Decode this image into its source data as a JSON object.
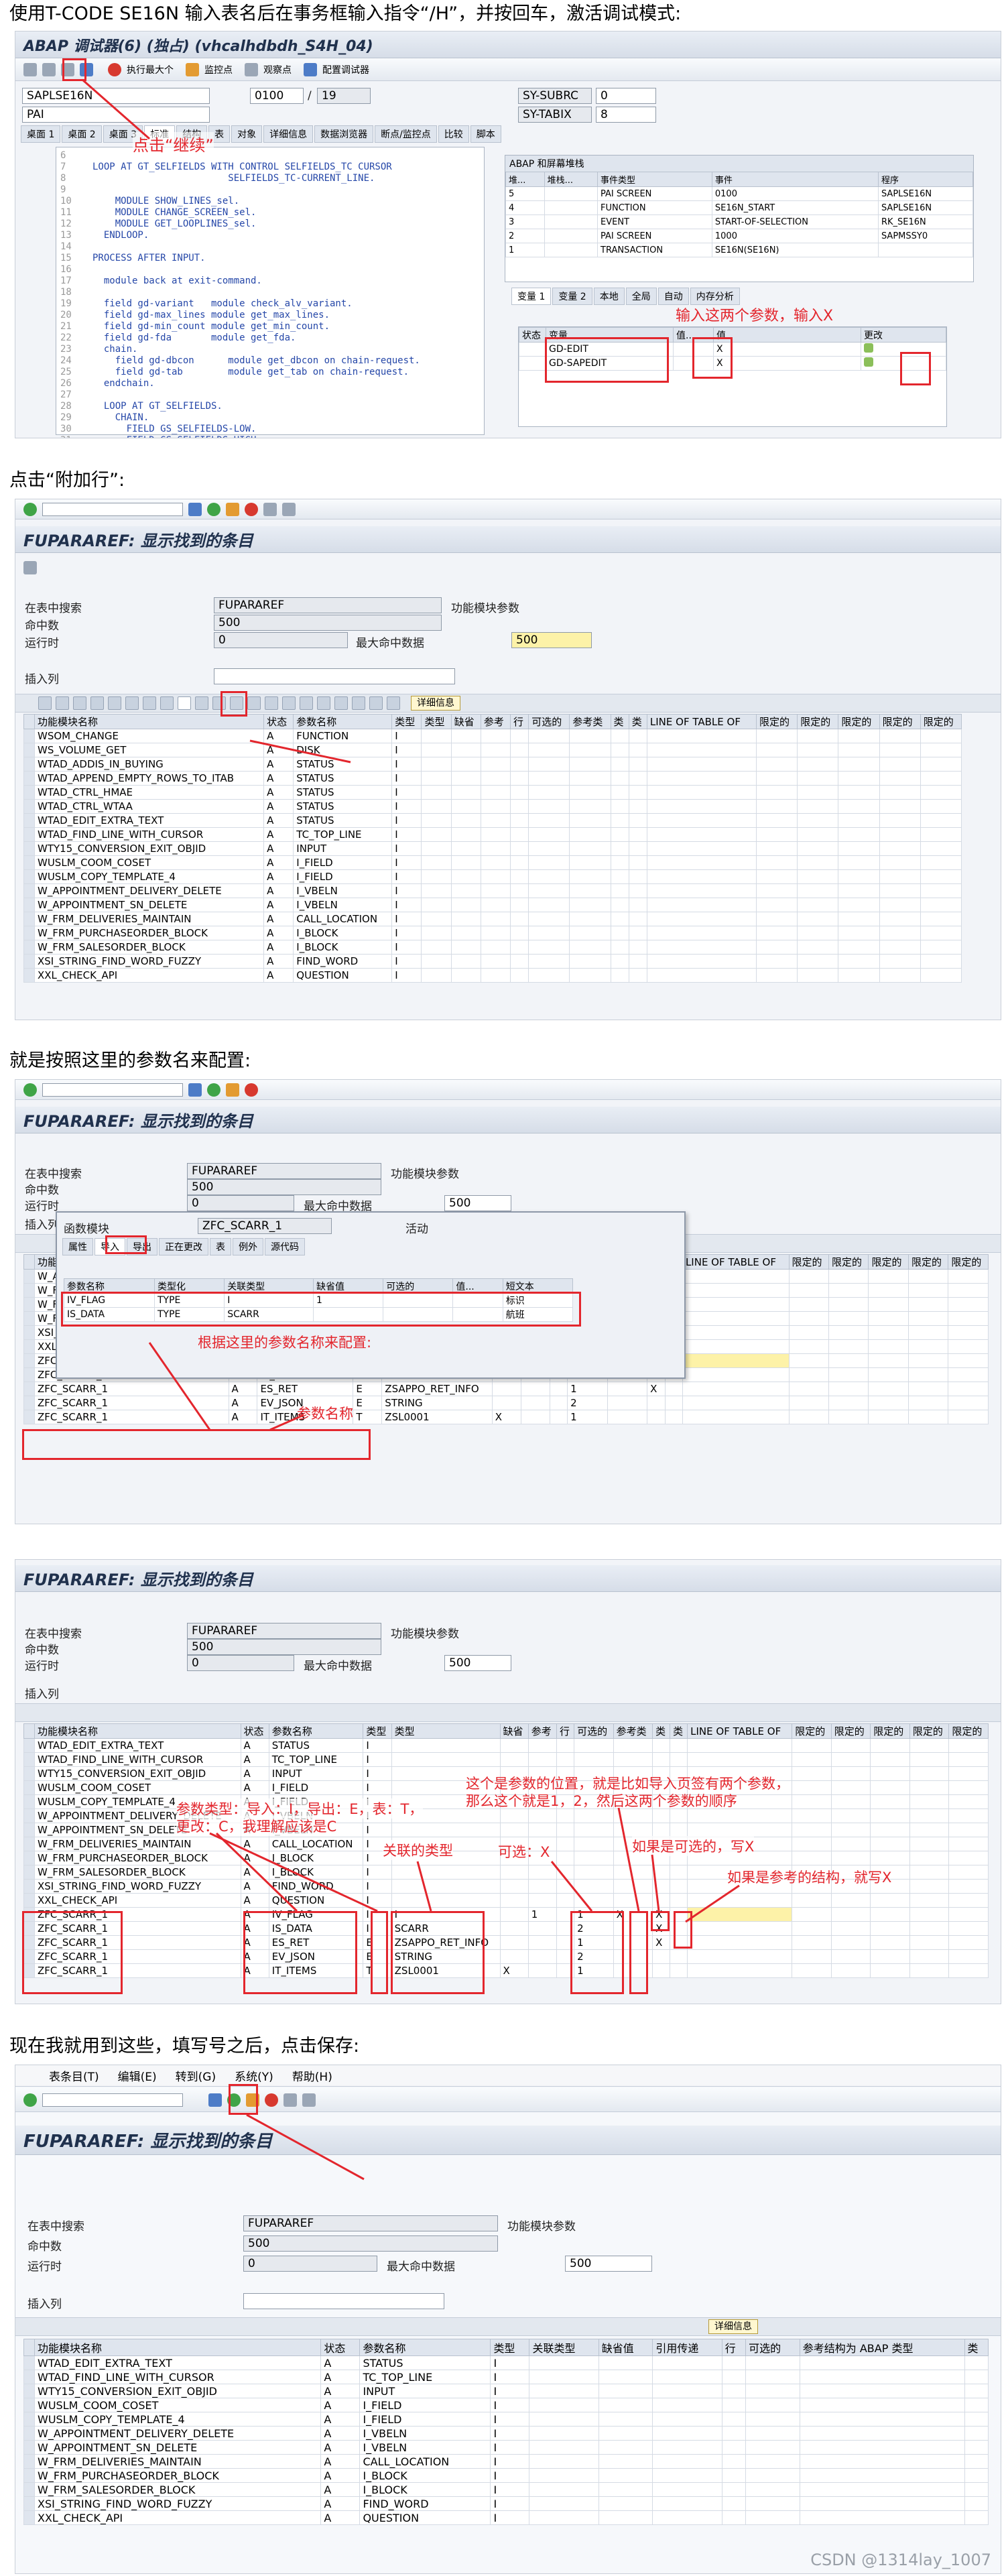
{
  "captions": {
    "step1": "使用T-CODE SE16N 输入表名后在事务框输入指令“/H”，并按回车，激活调试模式:",
    "step2": "点击“附加行”:",
    "step3": "就是按照这里的参数名来配置:",
    "step5": "现在我就用到这些，填写号之后，点击保存:"
  },
  "shot1": {
    "title": "ABAP 调试器(6) (独占) (vhcalhdbdh_S4H_04)",
    "toolbar_labels": [
      "执行最大个",
      "监控点",
      "观察点",
      "配置调试器"
    ],
    "program_field": "SAPLSE16N",
    "line_field": "0100",
    "line_total": "19",
    "pai_field": "PAI",
    "sy_fields": [
      {
        "name": "SY-SUBRC",
        "value": "0"
      },
      {
        "name": "SY-TABIX",
        "value": "8"
      }
    ],
    "tabs": [
      "桌面 1",
      "桌面 2",
      "桌面 3",
      "标准",
      "结构",
      "表",
      "对象",
      "详细信息",
      "数据浏览器",
      "断点/监控点",
      "比较",
      "脚本"
    ],
    "code_lines": [
      {
        "n": "6",
        "t": ""
      },
      {
        "n": "7",
        "t": "LOOP AT GT_SELFIELDS WITH CONTROL SELFIELDS_TC CURSOR"
      },
      {
        "n": "8",
        "t": "                        SELFIELDS_TC-CURRENT_LINE."
      },
      {
        "n": "9",
        "t": ""
      },
      {
        "n": "10",
        "t": "    MODULE SHOW_LINES_sel."
      },
      {
        "n": "11",
        "t": "    MODULE CHANGE_SCREEN_sel."
      },
      {
        "n": "12",
        "t": "    MODULE GET_LOOPLINES_sel."
      },
      {
        "n": "13",
        "t": "  ENDLOOP."
      },
      {
        "n": "14",
        "t": ""
      },
      {
        "n": "15",
        "t": "PROCESS AFTER INPUT."
      },
      {
        "n": "16",
        "t": ""
      },
      {
        "n": "17",
        "t": "  module back at exit-command."
      },
      {
        "n": "18",
        "t": ""
      },
      {
        "n": "19",
        "t": "  field gd-variant   module check_alv_variant."
      },
      {
        "n": "20",
        "t": "  field gd-max_lines module get_max_lines."
      },
      {
        "n": "21",
        "t": "  field gd-min_count module get_min_count."
      },
      {
        "n": "22",
        "t": "  field gd-fda       module get_fda."
      },
      {
        "n": "23",
        "t": "  chain."
      },
      {
        "n": "24",
        "t": "    field gd-dbcon      module get_dbcon on chain-request."
      },
      {
        "n": "25",
        "t": "    field gd-tab        module get_tab on chain-request."
      },
      {
        "n": "26",
        "t": "  endchain."
      },
      {
        "n": "27",
        "t": ""
      },
      {
        "n": "28",
        "t": "  LOOP AT GT_SELFIELDS."
      },
      {
        "n": "29",
        "t": "    CHAIN."
      },
      {
        "n": "30",
        "t": "      FIELD GS_SELFIELDS-LOW."
      },
      {
        "n": "31",
        "t": "      FIELD GS_SELFIELDS-HIGH."
      }
    ],
    "stack_title": "ABAP 和屏幕堆栈",
    "stack_headers": [
      "堆...",
      "堆栈...",
      "事件类型",
      "事件",
      "程序"
    ],
    "stack_rows": [
      [
        "5",
        "",
        "PAI SCREEN",
        "0100",
        "SAPLSE16N"
      ],
      [
        "4",
        "",
        "FUNCTION",
        "SE16N_START",
        "SAPLSE16N"
      ],
      [
        "3",
        "",
        "EVENT",
        "START-OF-SELECTION",
        "RK_SE16N"
      ],
      [
        "2",
        "",
        "PAI SCREEN",
        "1000",
        "SAPMSSY0"
      ],
      [
        "1",
        "",
        "TRANSACTION",
        "SE16N(SE16N)",
        ""
      ]
    ],
    "var_tabs": [
      "变量 1",
      "变量 2",
      "本地",
      "全局",
      "自动",
      "内存分析"
    ],
    "var_headers": [
      "状态",
      "变量",
      "值...",
      "值"
    ],
    "var_rows": [
      [
        "",
        "GD-EDIT",
        "",
        "X"
      ],
      [
        "",
        "GD-SAPEDIT",
        "",
        "X"
      ]
    ],
    "var_change_col": "更改",
    "annotations": {
      "continue": "点击“继续”",
      "enter_params": "输入这两个参数，输入X"
    }
  },
  "shot2": {
    "title": "FUPARAREF: 显示找到的条目",
    "labels": {
      "table": "在表中搜索",
      "hits": "命中数",
      "runtime": "运行时",
      "max_hits": "最大命中数据",
      "insert_row": "插入列",
      "table_desc": "功能模块参数"
    },
    "table_value": "FUPARAREF",
    "hits_value": "500",
    "runtime_value": "0",
    "max_value": "500",
    "detail_button": "详细信息",
    "headers": [
      "功能模块名称",
      "状态",
      "参数名称",
      "类型",
      "类型",
      "缺省",
      "参考",
      "行",
      "可选的",
      "参考类",
      "类",
      "类",
      "LINE OF TABLE OF",
      "限定的",
      "限定的",
      "限定的",
      "限定的",
      "限定的"
    ],
    "rows": [
      [
        "WSOM_CHANGE",
        "A",
        "FUNCTION",
        "I"
      ],
      [
        "WS_VOLUME_GET",
        "A",
        "DISK",
        "I"
      ],
      [
        "WTAD_ADDIS_IN_BUYING",
        "A",
        "STATUS",
        "I"
      ],
      [
        "WTAD_APPEND_EMPTY_ROWS_TO_ITAB",
        "A",
        "STATUS",
        "I"
      ],
      [
        "WTAD_CTRL_HMAE",
        "A",
        "STATUS",
        "I"
      ],
      [
        "WTAD_CTRL_WTAA",
        "A",
        "STATUS",
        "I"
      ],
      [
        "WTAD_EDIT_EXTRA_TEXT",
        "A",
        "STATUS",
        "I"
      ],
      [
        "WTAD_FIND_LINE_WITH_CURSOR",
        "A",
        "TC_TOP_LINE",
        "I"
      ],
      [
        "WTY15_CONVERSION_EXIT_OBJID",
        "A",
        "INPUT",
        "I"
      ],
      [
        "WUSLM_COOM_COSET",
        "A",
        "I_FIELD",
        "I"
      ],
      [
        "WUSLM_COPY_TEMPLATE_4",
        "A",
        "I_FIELD",
        "I"
      ],
      [
        "W_APPOINTMENT_DELIVERY_DELETE",
        "A",
        "I_VBELN",
        "I"
      ],
      [
        "W_APPOINTMENT_SN_DELETE",
        "A",
        "I_VBELN",
        "I"
      ],
      [
        "W_FRM_DELIVERIES_MAINTAIN",
        "A",
        "CALL_LOCATION",
        "I"
      ],
      [
        "W_FRM_PURCHASEORDER_BLOCK",
        "A",
        "I_BLOCK",
        "I"
      ],
      [
        "W_FRM_SALESORDER_BLOCK",
        "A",
        "I_BLOCK",
        "I"
      ],
      [
        "XSI_STRING_FIND_WORD_FUZZY",
        "A",
        "FIND_WORD",
        "I"
      ],
      [
        "XXL_CHECK_API",
        "A",
        "QUESTION",
        "I"
      ]
    ]
  },
  "shot3": {
    "title": "FUPARAREF: 显示找到的条目",
    "popup": {
      "fm_label": "函数模块",
      "fm_value": "ZFC_SCARR_1",
      "status": "活动",
      "tabs": [
        "属性",
        "导入",
        "导出",
        "正在更改",
        "表",
        "例外",
        "源代码"
      ],
      "headers": [
        "参数名称",
        "类型化",
        "关联类型",
        "缺省值",
        "可选的",
        "值...",
        "短文本"
      ],
      "rows": [
        [
          "IV_FLAG",
          "TYPE",
          "I",
          "1",
          "",
          "",
          "标识"
        ],
        [
          "IS_DATA",
          "TYPE",
          "SCARR",
          "",
          "",
          "",
          "航班"
        ]
      ]
    },
    "rows": [
      [
        "W_APPOINTMENT_SN_DELETE",
        "A",
        "I_VBELN",
        "I"
      ],
      [
        "W_FRM_DELIVERIES_MAINTAIN",
        "A",
        "CALL_LOCATION",
        "I"
      ],
      [
        "W_FRM_PURCHASEORDER_BLOCK",
        "A",
        "I_BLOCK",
        "I"
      ],
      [
        "W_FRM_SALESORDER_BLOCK",
        "A",
        "I_BLOCK",
        "I"
      ],
      [
        "XSI_STRING_FIND_WORD_FUZZY",
        "A",
        "FIND_WORD",
        "I"
      ],
      [
        "XXL_CHECK_API",
        "A",
        "QUESTION",
        "I"
      ]
    ],
    "zrows": [
      [
        "ZFC_SCARR_1",
        "A",
        "IV_FLAG",
        "I",
        "I",
        "",
        "1",
        "",
        "1",
        "X",
        "X"
      ],
      [
        "ZFC_SCARR_1",
        "A",
        "IS_DATA",
        "I",
        "SCARR",
        "",
        "",
        "",
        "2",
        "",
        "X"
      ],
      [
        "ZFC_SCARR_1",
        "A",
        "ES_RET",
        "E",
        "ZSAPPO_RET_INFO",
        "",
        "",
        "",
        "1",
        "",
        "X"
      ],
      [
        "ZFC_SCARR_1",
        "A",
        "EV_JSON",
        "E",
        "STRING",
        "",
        "",
        "",
        "2",
        "",
        ""
      ],
      [
        "ZFC_SCARR_1",
        "A",
        "IT_ITEMS",
        "T",
        "ZSL0001",
        "X",
        "",
        "",
        "1",
        "",
        ""
      ]
    ],
    "annotations": {
      "config": "根据这里的参数名称来配置:",
      "param_name": "参数名称"
    }
  },
  "shot4": {
    "title": "FUPARAREF: 显示找到的条目",
    "rows": [
      [
        "WTAD_EDIT_EXTRA_TEXT",
        "A",
        "STATUS",
        "I"
      ],
      [
        "WTAD_FIND_LINE_WITH_CURSOR",
        "A",
        "TC_TOP_LINE",
        "I"
      ],
      [
        "WTY15_CONVERSION_EXIT_OBJID",
        "A",
        "INPUT",
        "I"
      ],
      [
        "WUSLM_COOM_COSET",
        "A",
        "I_FIELD",
        "I"
      ],
      [
        "WUSLM_COPY_TEMPLATE_4",
        "A",
        "I_FIELD",
        "I"
      ],
      [
        "W_APPOINTMENT_DELIVERY_DELETE",
        "A",
        "I_VBELN",
        "I"
      ],
      [
        "W_APPOINTMENT_SN_DELETE",
        "A",
        "I_VBELN",
        "I"
      ],
      [
        "W_FRM_DELIVERIES_MAINTAIN",
        "A",
        "CALL_LOCATION",
        "I"
      ],
      [
        "W_FRM_PURCHASEORDER_BLOCK",
        "A",
        "I_BLOCK",
        "I"
      ],
      [
        "W_FRM_SALESORDER_BLOCK",
        "A",
        "I_BLOCK",
        "I"
      ],
      [
        "XSI_STRING_FIND_WORD_FUZZY",
        "A",
        "FIND_WORD",
        "I"
      ],
      [
        "XXL_CHECK_API",
        "A",
        "QUESTION",
        "I"
      ]
    ],
    "annotations": {
      "position": "这个是参数的位置，就是比如导入页签有两个参数，",
      "position2": "那么这个就是1，2，然后这两个参数的顺序",
      "ptype": "参数类型：导入：I，导出：E，表：T，",
      "ptype2": "更改：C，我理解应该是C",
      "assoc": "关联的类型",
      "optional": "可选：X",
      "optional2": "如果是可选的，写X",
      "ref": "如果是参考的结构，就写X"
    }
  },
  "shot5": {
    "menu": [
      "表条目(T)",
      "编辑(E)",
      "转到(G)",
      "系统(Y)",
      "帮助(H)"
    ],
    "title": "FUPARAREF: 显示找到的条目",
    "headers": [
      "功能模块名称",
      "状态",
      "参数名称",
      "类型",
      "关联类型",
      "缺省值",
      "引用传递",
      "行",
      "可选的",
      "参考结构为 ABAP 类型",
      "类"
    ],
    "rows": [
      [
        "WTAD_EDIT_EXTRA_TEXT",
        "A",
        "STATUS",
        "I"
      ],
      [
        "WTAD_FIND_LINE_WITH_CURSOR",
        "A",
        "TC_TOP_LINE",
        "I"
      ],
      [
        "WTY15_CONVERSION_EXIT_OBJID",
        "A",
        "INPUT",
        "I"
      ],
      [
        "WUSLM_COOM_COSET",
        "A",
        "I_FIELD",
        "I"
      ],
      [
        "WUSLM_COPY_TEMPLATE_4",
        "A",
        "I_FIELD",
        "I"
      ],
      [
        "W_APPOINTMENT_DELIVERY_DELETE",
        "A",
        "I_VBELN",
        "I"
      ],
      [
        "W_APPOINTMENT_SN_DELETE",
        "A",
        "I_VBELN",
        "I"
      ],
      [
        "W_FRM_DELIVERIES_MAINTAIN",
        "A",
        "CALL_LOCATION",
        "I"
      ],
      [
        "W_FRM_PURCHASEORDER_BLOCK",
        "A",
        "I_BLOCK",
        "I"
      ],
      [
        "W_FRM_SALESORDER_BLOCK",
        "A",
        "I_BLOCK",
        "I"
      ],
      [
        "XSI_STRING_FIND_WORD_FUZZY",
        "A",
        "FIND_WORD",
        "I"
      ],
      [
        "XXL_CHECK_API",
        "A",
        "QUESTION",
        "I"
      ]
    ]
  },
  "footer": "CSDN @1314lay_1007",
  "colors": {
    "annotation": "#e3262d",
    "sap_header": "#dfe5ee",
    "highlight": "#fdf2a8"
  }
}
